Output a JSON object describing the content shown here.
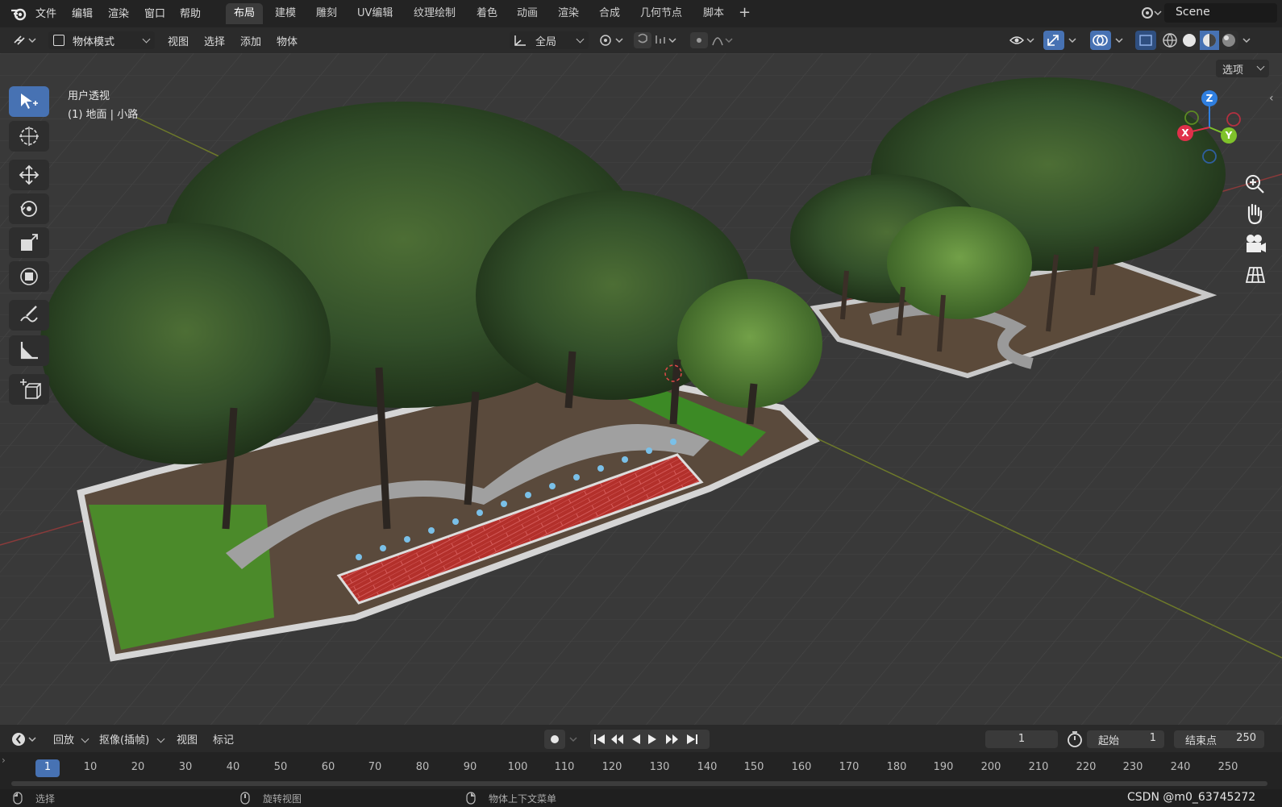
{
  "top_menu": [
    "文件",
    "编辑",
    "渲染",
    "窗口",
    "帮助"
  ],
  "workspace_tabs": [
    "布局",
    "建模",
    "雕刻",
    "UV编辑",
    "纹理绘制",
    "着色",
    "动画",
    "渲染",
    "合成",
    "几何节点",
    "脚本"
  ],
  "active_workspace": "布局",
  "scene_name": "Scene",
  "header": {
    "mode": "物体模式",
    "menus": [
      "视图",
      "选择",
      "添加",
      "物体"
    ],
    "orientation": "全局",
    "options": "选项"
  },
  "viewport": {
    "view_name": "用户透视",
    "object_info": "(1) 地面 | 小路",
    "gizmo_axes": {
      "x": "X",
      "y": "Y",
      "z": "Z"
    },
    "colors": {
      "x_axis": "#e0304a",
      "y_axis": "#7fc22b",
      "z_axis": "#2f7fe0",
      "active_tool": "#4772b3"
    }
  },
  "toolbar_icons": [
    "select-box-icon",
    "cursor-icon",
    "move-icon",
    "rotate-icon",
    "scale-icon",
    "transform-icon",
    "annotate-icon",
    "measure-icon",
    "add-cube-icon"
  ],
  "nav_icons": [
    "zoom-icon",
    "pan-hand-icon",
    "camera-icon",
    "grid-view-icon"
  ],
  "timeline": {
    "playback": "回放",
    "keying": "抠像(插帧)",
    "view": "视图",
    "marker": "标记",
    "current_frame": "1",
    "start_label": "起始",
    "start_value": "1",
    "end_label": "结束点",
    "end_value": "250",
    "frames": [
      "1",
      "10",
      "20",
      "30",
      "40",
      "50",
      "60",
      "70",
      "80",
      "90",
      "100",
      "110",
      "120",
      "130",
      "140",
      "150",
      "160",
      "170",
      "180",
      "190",
      "200",
      "210",
      "220",
      "230",
      "240",
      "250"
    ]
  },
  "statusbar": {
    "select": "选择",
    "rotate_view": "旋转视图",
    "context_menu": "物体上下文菜单",
    "watermark": "CSDN @m0_63745272"
  }
}
